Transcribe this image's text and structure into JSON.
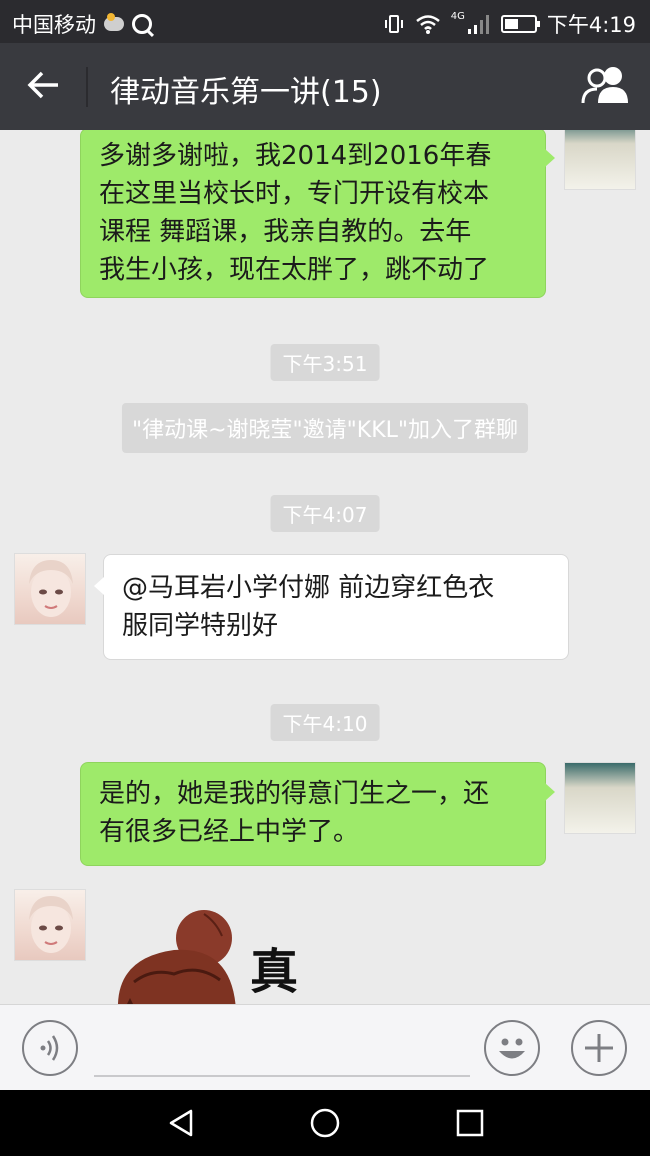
{
  "status_bar": {
    "carrier": "中国移动",
    "network": "4G",
    "time": "下午4:19"
  },
  "header": {
    "title": "律动音乐第一讲(15)"
  },
  "messages": [
    {
      "type": "self",
      "lines": [
        "多谢多谢啦，我2014到2016年春",
        "在这里当校长时，专门开设有校本",
        "课程   舞蹈课，我亲自教的。去年",
        "我生小孩，现在太胖了，跳不动了"
      ]
    },
    {
      "type": "time",
      "text": "下午3:51"
    },
    {
      "type": "system",
      "text": "\"律动课~谢晓莹\"邀请\"KKL\"加入了群聊"
    },
    {
      "type": "time",
      "text": "下午4:07"
    },
    {
      "type": "other",
      "lines": [
        "@马耳岩小学付娜 前边穿红色衣",
        "服同学特别好"
      ]
    },
    {
      "type": "time",
      "text": "下午4:10"
    },
    {
      "type": "self",
      "lines": [
        "是的，她是我的得意门生之一，还",
        "有很多已经上中学了。"
      ]
    },
    {
      "type": "other-sticker",
      "sticker_text": "真"
    }
  ],
  "input": {
    "placeholder": ""
  },
  "icons": {
    "back": "back-arrow-icon",
    "group": "group-members-icon",
    "voice": "voice-icon",
    "emoji": "emoji-icon",
    "plus": "plus-icon"
  }
}
